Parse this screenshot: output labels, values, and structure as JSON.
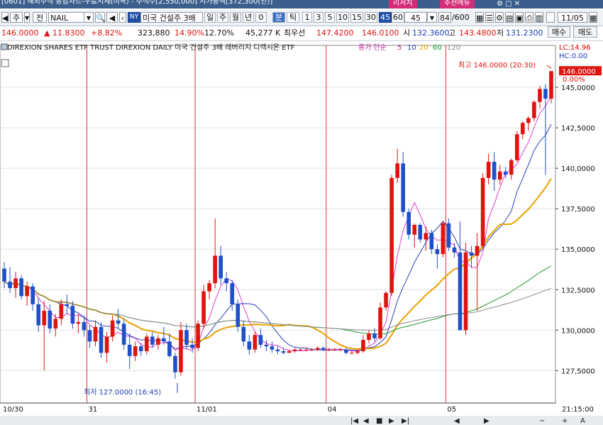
{
  "title_bar": {
    "text": "[0601] 해외주식 종합차트-무료시세(미국) - 주식수[2,550,000] 시가총액[372,300(천)]",
    "btn_research": "리서치",
    "btn_recommend": "추천메뉴"
  },
  "toolbar": {
    "side_label": "주",
    "mode_label": "전",
    "symbol": "NAIL",
    "market_badge": "NY",
    "name_short": "미국 건설주 3배",
    "periods": [
      "일",
      "주",
      "월",
      "년",
      "0"
    ],
    "unit_label": "분",
    "tick_label": "틱",
    "intervals": [
      "1",
      "3",
      "5",
      "10",
      "15",
      "30",
      "45",
      "60",
      "45"
    ],
    "selected_interval": "45",
    "count_value": "84",
    "count_total": "/600",
    "date_value": "11/05"
  },
  "quote": {
    "price": "146.0000",
    "change": "▲ 11.8300",
    "change_pct": "+8.82%",
    "volume": "323,880",
    "vol_pct1": "14.90%",
    "vol_pct2": "12.70%",
    "amount": "45,277 K",
    "best_ask_label": "최우선",
    "ask": "147.4200",
    "bid": "146.0100",
    "open_label": "시",
    "open": "132.3600",
    "high_label": "고",
    "high": "143.4800",
    "low_label": "저",
    "low": "131.2300",
    "buy_label": "매수",
    "sell_label": "매도"
  },
  "chart_header": {
    "name": "DIREXION SHARES ETF TRUST DIREXION DAILY 미국 건설주 3배 레버리지 디렉시온 ETF",
    "ma_label": "종가 단순",
    "ma_periods": [
      "5",
      "10",
      "20",
      "60",
      "120"
    ],
    "lc": "LC:14.96",
    "hc": "HC:0.00"
  },
  "annotations": {
    "high_note": "최고 146.0000 (20:30)",
    "low_note": "최저 127.0000 (16:45)",
    "last_price": "146.0000",
    "last_pct": "0.00%"
  },
  "chart_data": {
    "type": "candlestick",
    "y_ticks": [
      127.5,
      130.0,
      132.5,
      135.0,
      137.5,
      140.0,
      142.5,
      145.0
    ],
    "y_tick_labels": [
      "127,5000",
      "130,0000",
      "132,5000",
      "135,0000",
      "137,5000",
      "140,0000",
      "142,5000",
      "145,0000"
    ],
    "ylim": [
      125.5,
      147.5
    ],
    "x_labels": [
      "10/30",
      "31",
      "11/01",
      "04",
      "05"
    ],
    "x_label_index": [
      0,
      15,
      34,
      57,
      78
    ],
    "time_label": "21:15:00",
    "day_separator_index": [
      15,
      34,
      57,
      78
    ],
    "candles": [
      [
        133.8,
        134.2,
        132.6,
        133.0
      ],
      [
        133.0,
        133.9,
        132.3,
        132.6
      ],
      [
        132.6,
        133.6,
        132.0,
        133.2
      ],
      [
        133.2,
        133.4,
        131.9,
        132.1
      ],
      [
        132.1,
        133.0,
        131.5,
        132.7
      ],
      [
        132.7,
        132.9,
        131.2,
        131.6
      ],
      [
        131.6,
        132.0,
        129.9,
        130.3
      ],
      [
        130.3,
        131.8,
        127.5,
        131.2
      ],
      [
        131.2,
        131.6,
        129.8,
        130.1
      ],
      [
        130.1,
        131.0,
        129.6,
        130.7
      ],
      [
        130.7,
        131.9,
        130.3,
        131.6
      ],
      [
        131.6,
        132.2,
        131.0,
        131.5
      ],
      [
        131.5,
        131.8,
        130.1,
        130.4
      ],
      [
        130.4,
        131.0,
        129.8,
        130.5
      ],
      [
        130.5,
        130.9,
        129.6,
        130.0
      ],
      [
        130.0,
        130.3,
        128.9,
        129.3
      ],
      [
        129.3,
        130.6,
        129.0,
        130.2
      ],
      [
        130.2,
        130.5,
        128.3,
        128.6
      ],
      [
        128.6,
        129.9,
        128.0,
        129.6
      ],
      [
        129.6,
        130.9,
        129.3,
        130.6
      ],
      [
        130.6,
        131.3,
        130.1,
        130.4
      ],
      [
        130.4,
        130.7,
        128.8,
        129.1
      ],
      [
        129.1,
        129.8,
        127.6,
        128.4
      ],
      [
        128.4,
        129.3,
        128.1,
        129.0
      ],
      [
        129.0,
        129.2,
        128.4,
        128.7
      ],
      [
        128.7,
        129.8,
        128.5,
        129.6
      ],
      [
        129.6,
        129.9,
        128.9,
        129.1
      ],
      [
        129.1,
        129.7,
        128.8,
        129.5
      ],
      [
        129.5,
        130.2,
        129.1,
        129.3
      ],
      [
        129.3,
        129.8,
        128.3,
        128.4
      ],
      [
        128.4,
        128.6,
        127.0,
        127.4
      ],
      [
        127.4,
        130.5,
        127.2,
        130.0
      ],
      [
        130.0,
        130.4,
        128.8,
        129.1
      ],
      [
        129.1,
        129.5,
        128.6,
        128.9
      ],
      [
        128.9,
        130.6,
        128.7,
        130.4
      ],
      [
        130.4,
        132.8,
        130.1,
        132.4
      ],
      [
        132.4,
        133.1,
        131.9,
        132.9
      ],
      [
        132.9,
        136.9,
        132.6,
        134.6
      ],
      [
        134.6,
        135.2,
        132.8,
        133.2
      ],
      [
        133.2,
        133.6,
        132.4,
        132.9
      ],
      [
        132.9,
        133.1,
        131.2,
        131.6
      ],
      [
        131.6,
        131.9,
        129.9,
        130.2
      ],
      [
        130.2,
        130.6,
        129.0,
        129.3
      ],
      [
        129.3,
        129.7,
        128.5,
        128.8
      ],
      [
        128.8,
        129.9,
        128.6,
        129.7
      ],
      [
        129.7,
        130.1,
        128.9,
        129.1
      ],
      [
        129.1,
        129.4,
        128.7,
        129.0
      ],
      [
        129.0,
        129.3,
        128.6,
        128.8
      ],
      [
        128.8,
        129.0,
        128.5,
        128.7
      ],
      [
        128.7,
        128.9,
        128.5,
        128.6
      ],
      [
        128.6,
        128.8,
        128.6,
        128.7
      ],
      [
        128.7,
        128.9,
        128.6,
        128.8
      ],
      [
        128.8,
        128.9,
        128.7,
        128.8
      ],
      [
        128.8,
        128.9,
        128.7,
        128.8
      ],
      [
        128.8,
        128.9,
        128.7,
        128.8
      ],
      [
        128.8,
        129.0,
        128.7,
        128.9
      ],
      [
        128.9,
        129.0,
        128.7,
        128.8
      ],
      [
        128.8,
        128.9,
        128.7,
        128.8
      ],
      [
        128.8,
        128.9,
        128.7,
        128.8
      ],
      [
        128.8,
        128.9,
        128.7,
        128.8
      ],
      [
        128.8,
        128.9,
        128.5,
        128.6
      ],
      [
        128.6,
        128.7,
        128.5,
        128.6
      ],
      [
        128.6,
        128.8,
        128.5,
        128.7
      ],
      [
        128.7,
        129.7,
        128.6,
        129.4
      ],
      [
        129.4,
        130.0,
        129.2,
        129.8
      ],
      [
        129.8,
        130.1,
        129.3,
        129.5
      ],
      [
        129.5,
        131.7,
        129.4,
        131.4
      ],
      [
        131.4,
        132.4,
        131.2,
        132.3
      ],
      [
        132.3,
        139.6,
        132.1,
        139.4
      ],
      [
        139.4,
        141.2,
        139.1,
        140.3
      ],
      [
        140.3,
        141.0,
        137.0,
        137.3
      ],
      [
        137.3,
        137.5,
        135.6,
        135.9
      ],
      [
        135.9,
        136.6,
        135.1,
        136.5
      ],
      [
        136.5,
        136.6,
        135.4,
        135.6
      ],
      [
        135.6,
        136.4,
        134.9,
        136.0
      ],
      [
        136.0,
        136.2,
        134.7,
        135.0
      ],
      [
        135.0,
        135.3,
        133.8,
        134.7
      ],
      [
        134.7,
        136.7,
        134.5,
        136.6
      ],
      [
        136.6,
        136.9,
        134.9,
        135.1
      ],
      [
        135.1,
        135.4,
        134.5,
        134.8
      ],
      [
        134.8,
        136.7,
        130.0,
        130.0
      ],
      [
        130.0,
        135.4,
        129.7,
        134.8
      ],
      [
        134.8,
        135.2,
        133.9,
        134.6
      ],
      [
        134.6,
        136.0,
        131.2,
        135.2
      ],
      [
        135.2,
        139.7,
        135.0,
        139.4
      ],
      [
        139.4,
        140.9,
        139.0,
        140.4
      ],
      [
        140.4,
        141.0,
        138.6,
        139.3
      ],
      [
        139.3,
        140.2,
        139.0,
        139.8
      ],
      [
        139.8,
        140.1,
        139.4,
        139.6
      ],
      [
        139.6,
        140.6,
        139.3,
        140.5
      ],
      [
        140.5,
        142.3,
        140.4,
        142.1
      ],
      [
        142.1,
        142.9,
        141.8,
        142.8
      ],
      [
        142.8,
        143.2,
        142.3,
        143.1
      ],
      [
        143.1,
        144.2,
        142.9,
        144.1
      ],
      [
        144.1,
        145.1,
        143.7,
        144.9
      ],
      [
        144.9,
        145.2,
        139.6,
        144.3
      ],
      [
        144.3,
        146.0,
        144.0,
        146.0
      ]
    ]
  }
}
